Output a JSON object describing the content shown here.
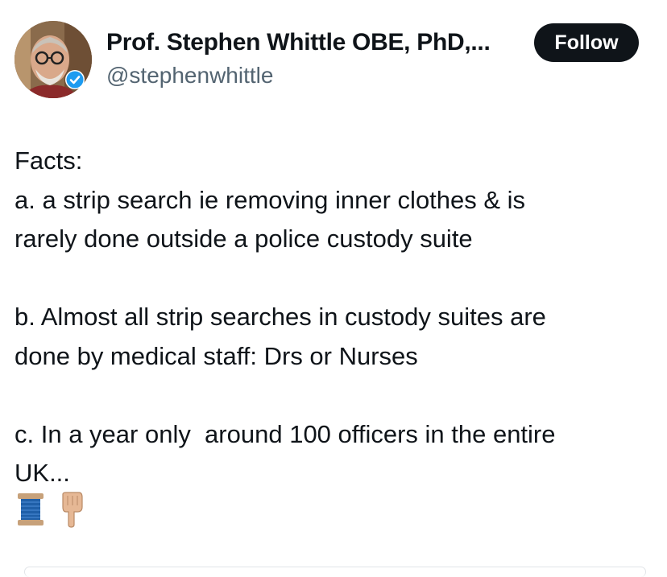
{
  "author": {
    "name": "Prof. Stephen Whittle OBE, PhD,...",
    "handle": "@stephenwhittle",
    "verified": true
  },
  "follow_button": {
    "label": "Follow"
  },
  "tweet": {
    "lines": [
      "Facts:",
      "a. a strip search ie removing inner clothes & is",
      "rarely done outside a police custody suite",
      "",
      "b. Almost all strip searches in custody suites are",
      "done by medical staff: Drs or Nurses",
      "",
      "c. In a year only  around 100 officers in the entire",
      "UK..."
    ],
    "emojis": [
      "spool-of-thread-icon",
      "pointing-down-hand-icon"
    ]
  },
  "colors": {
    "text": "#0f1419",
    "secondary_text": "#536471",
    "follow_bg": "#0f1419",
    "verified_blue": "#1d9bf0"
  }
}
